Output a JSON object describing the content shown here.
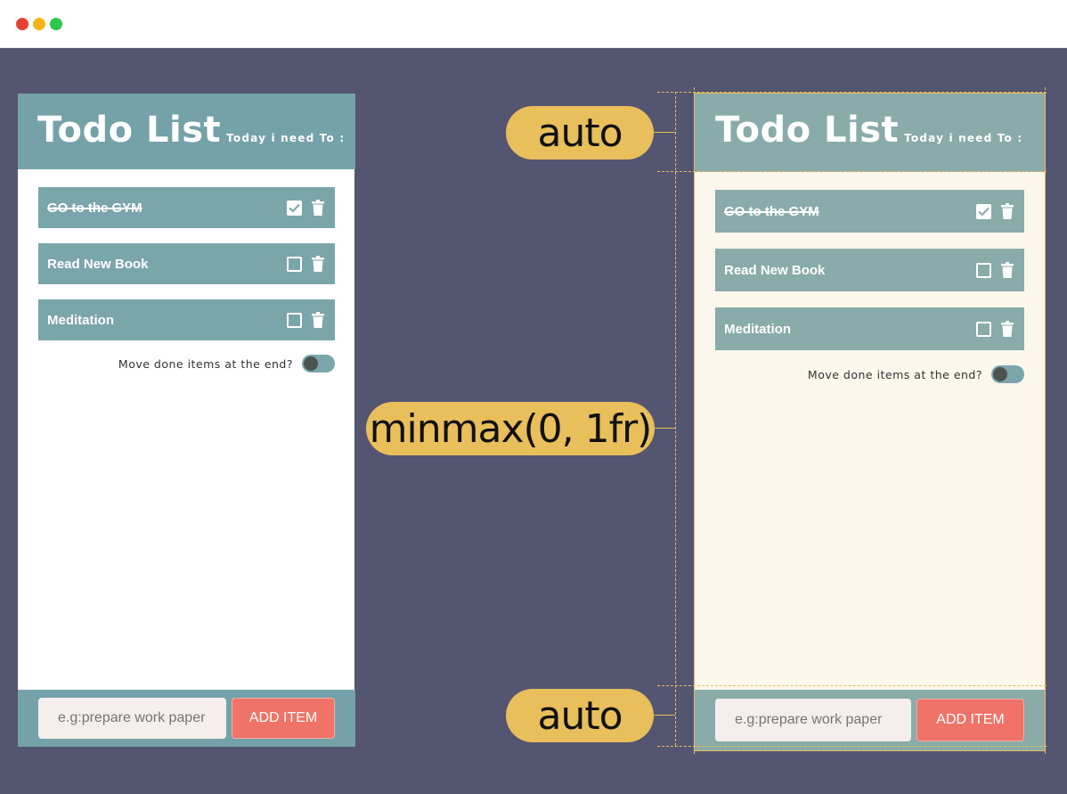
{
  "colors": {
    "background": "#545571",
    "header_teal": "#75a1a8",
    "item_teal": "#89aba9",
    "left_item_teal": "#7aa5ab",
    "cream": "#fcf7ed",
    "pill_yellow": "#e9bf5b",
    "add_button": "#ef7368",
    "input_bg": "#f4efed",
    "toggle_bg": "#7aa5ab",
    "window_dots": [
      "#e8422f",
      "#f5b519",
      "#2dc74d"
    ]
  },
  "todo_app": {
    "title": "Todo List",
    "subtitle": "Today i need To :",
    "items": [
      {
        "label": "GO to the GYM",
        "done": true
      },
      {
        "label": "Read New Book",
        "done": false
      },
      {
        "label": "Meditation",
        "done": false
      }
    ],
    "toggle_label": "Move done items at the end?",
    "input_placeholder": "e.g:prepare work paper",
    "add_button_label": "ADD ITEM"
  },
  "annotations": {
    "header_row": "auto",
    "body_row": "minmax(0, 1fr)",
    "footer_row": "auto"
  }
}
